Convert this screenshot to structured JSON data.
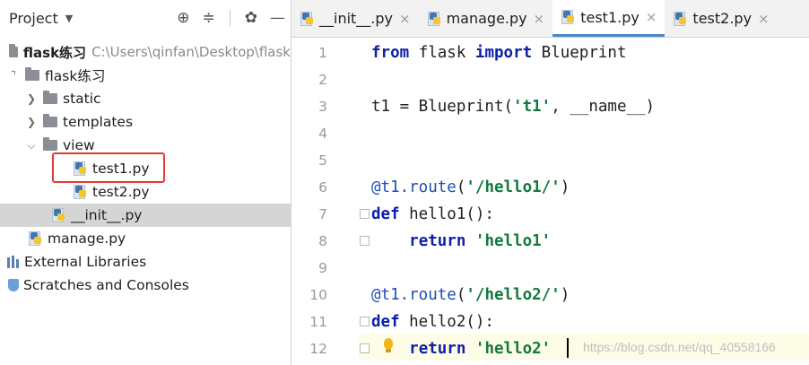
{
  "project_panel": {
    "title": "Project",
    "tree": [
      {
        "label": "flask练习",
        "path": "C:\\Users\\qinfan\\Desktop\\flask"
      },
      {
        "label": "flask练习"
      },
      {
        "label": "static"
      },
      {
        "label": "templates"
      },
      {
        "label": "view"
      },
      {
        "label": "test1.py"
      },
      {
        "label": "test2.py"
      },
      {
        "label": "__init__.py"
      },
      {
        "label": "manage.py"
      },
      {
        "label": "External Libraries"
      },
      {
        "label": "Scratches and Consoles"
      }
    ]
  },
  "tabs": [
    {
      "label": "__init__.py"
    },
    {
      "label": "manage.py"
    },
    {
      "label": "test1.py"
    },
    {
      "label": "test2.py"
    }
  ],
  "line_numbers": [
    "1",
    "2",
    "3",
    "4",
    "5",
    "6",
    "7",
    "8",
    "9",
    "10",
    "11",
    "12"
  ],
  "code": {
    "l1": {
      "from": "from",
      "mod": " flask ",
      "imp": "import",
      "name": " Blueprint"
    },
    "l3": {
      "pre": "t1 = Blueprint(",
      "s": "'t1'",
      "post": ", __name__)"
    },
    "l6": {
      "dec": "@t1.route",
      "p1": "(",
      "s": "'/hello1/'",
      "p2": ")"
    },
    "l7": {
      "kw": "def",
      "rest": " hello1():"
    },
    "l8": {
      "indent": "    ",
      "kw": "return",
      "sp": " ",
      "s": "'hello1'"
    },
    "l10": {
      "dec": "@t1.route",
      "p1": "(",
      "s": "'/hello2/'",
      "p2": ")"
    },
    "l11": {
      "kw": "def",
      "rest": " hello2():"
    },
    "l12": {
      "indent": "    ",
      "kw": "return",
      "sp": " ",
      "s": "'hello2'"
    }
  },
  "watermark": "https://blog.csdn.net/qq_40558166",
  "colors": {
    "keyword": "#0b1ea8",
    "string": "#117a3c",
    "selection_box": "#e53935",
    "active_tab": "#4a88c7"
  }
}
